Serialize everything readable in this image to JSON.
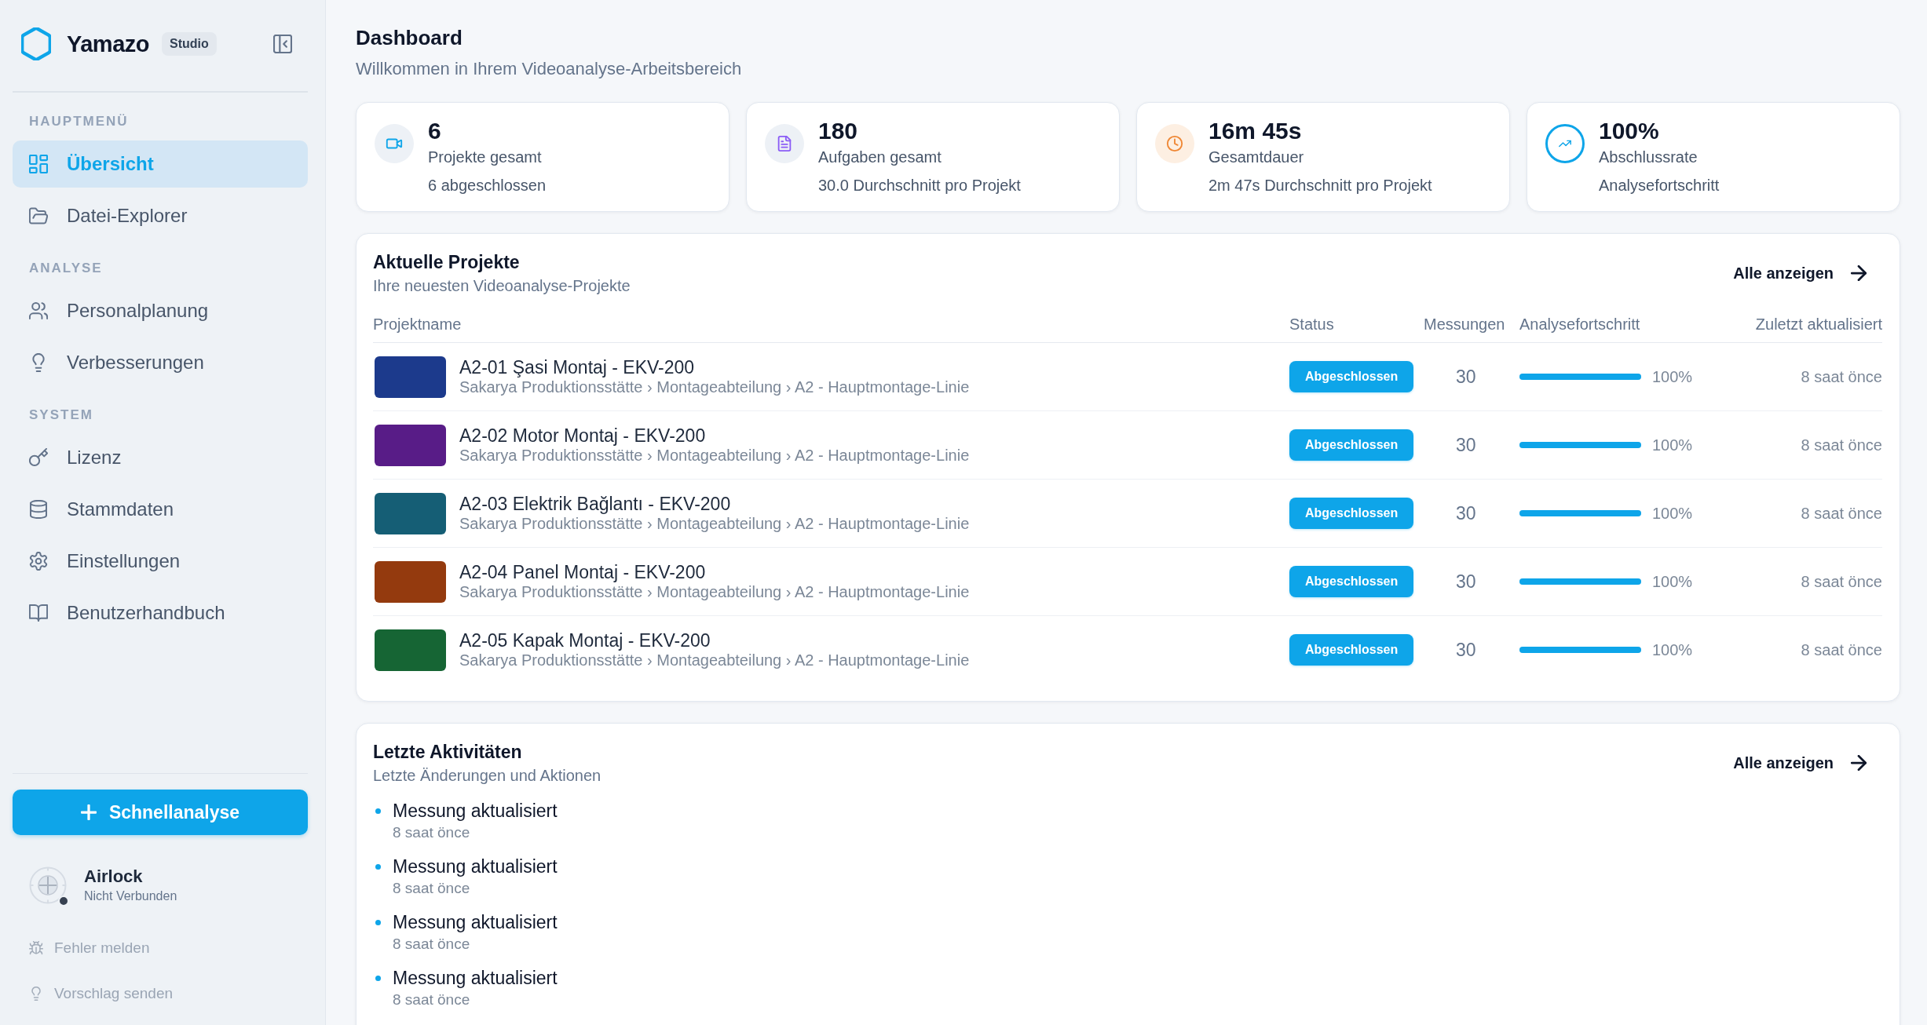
{
  "sidebar": {
    "brand": {
      "name": "Yamazo",
      "badge": "Studio"
    },
    "sections": [
      {
        "title": "HAUPTMENÜ",
        "items": [
          {
            "label": "Übersicht",
            "selected": true
          },
          {
            "label": "Datei-Explorer",
            "selected": false
          }
        ]
      },
      {
        "title": "ANALYSE",
        "items": [
          {
            "label": "Personalplanung",
            "selected": false
          },
          {
            "label": "Verbesserungen",
            "selected": false
          }
        ]
      },
      {
        "title": "SYSTEM",
        "items": [
          {
            "label": "Lizenz",
            "selected": false
          },
          {
            "label": "Stammdaten",
            "selected": false
          },
          {
            "label": "Einstellungen",
            "selected": false
          },
          {
            "label": "Benutzerhandbuch",
            "selected": false
          }
        ]
      }
    ],
    "quick_action": "Schnellanalyse",
    "connection": {
      "name": "Airlock",
      "status": "Nicht Verbunden",
      "connected": false
    },
    "footer_links": [
      "Fehler melden",
      "Vorschlag senden"
    ]
  },
  "header": {
    "title": "Dashboard",
    "subtitle": "Willkommen in Ihrem Videoanalyse-Arbeitsbereich"
  },
  "stats": [
    {
      "value": "6",
      "label": "Projekte gesamt",
      "detail": "6 abgeschlossen"
    },
    {
      "value": "180",
      "label": "Aufgaben gesamt",
      "detail": "30.0 Durchschnitt pro Projekt"
    },
    {
      "value": "16m 45s",
      "label": "Gesamtdauer",
      "detail": "2m 47s Durchschnitt pro Projekt"
    },
    {
      "value": "100%",
      "label": "Abschlussrate",
      "detail": "Analysefortschritt"
    }
  ],
  "projects": {
    "title": "Aktuelle Projekte",
    "subtitle": "Ihre neuesten Videoanalyse-Projekte",
    "link": "Alle anzeigen",
    "columns": [
      "Projektname",
      "Status",
      "Messungen",
      "Analysefortschritt",
      "Zuletzt aktualisiert"
    ],
    "rows": [
      {
        "name": "A2-01 Şasi Montaj - EKV-200",
        "path": "Sakarya Produktionsstätte › Montageabteilung › A2 - Hauptmontage-Linie",
        "color": "#1c3a8c",
        "status": "Abgeschlossen",
        "measurements": "30",
        "level": 1,
        "progress": "100%",
        "updated": "8 saat önce"
      },
      {
        "name": "A2-02 Motor Montaj - EKV-200",
        "path": "Sakarya Produktionsstätte › Montageabteilung › A2 - Hauptmontage-Linie",
        "color": "#581c87",
        "status": "Abgeschlossen",
        "measurements": "30",
        "level": 1,
        "progress": "100%",
        "updated": "8 saat önce"
      },
      {
        "name": "A2-03 Elektrik Bağlantı - EKV-200",
        "path": "Sakarya Produktionsstätte › Montageabteilung › A2 - Hauptmontage-Linie",
        "color": "#155e75",
        "status": "Abgeschlossen",
        "measurements": "30",
        "level": 1,
        "progress": "100%",
        "updated": "8 saat önce"
      },
      {
        "name": "A2-04 Panel Montaj - EKV-200",
        "path": "Sakarya Produktionsstätte › Montageabteilung › A2 - Hauptmontage-Linie",
        "color": "#943a0e",
        "status": "Abgeschlossen",
        "measurements": "30",
        "level": 1,
        "progress": "100%",
        "updated": "8 saat önce"
      },
      {
        "name": "A2-05 Kapak Montaj - EKV-200",
        "path": "Sakarya Produktionsstätte › Montageabteilung › A2 - Hauptmontage-Linie",
        "color": "#166534",
        "status": "Abgeschlossen",
        "measurements": "30",
        "level": 1,
        "progress": "100%",
        "updated": "8 saat önce"
      }
    ]
  },
  "activities": {
    "title": "Letzte Aktivitäten",
    "subtitle": "Letzte Änderungen und Aktionen",
    "link": "Alle anzeigen",
    "items": [
      {
        "text": "Messung aktualisiert",
        "time": "8 saat önce"
      },
      {
        "text": "Messung aktualisiert",
        "time": "8 saat önce"
      },
      {
        "text": "Messung aktualisiert",
        "time": "8 saat önce"
      },
      {
        "text": "Messung aktualisiert",
        "time": "8 saat önce"
      }
    ]
  }
}
